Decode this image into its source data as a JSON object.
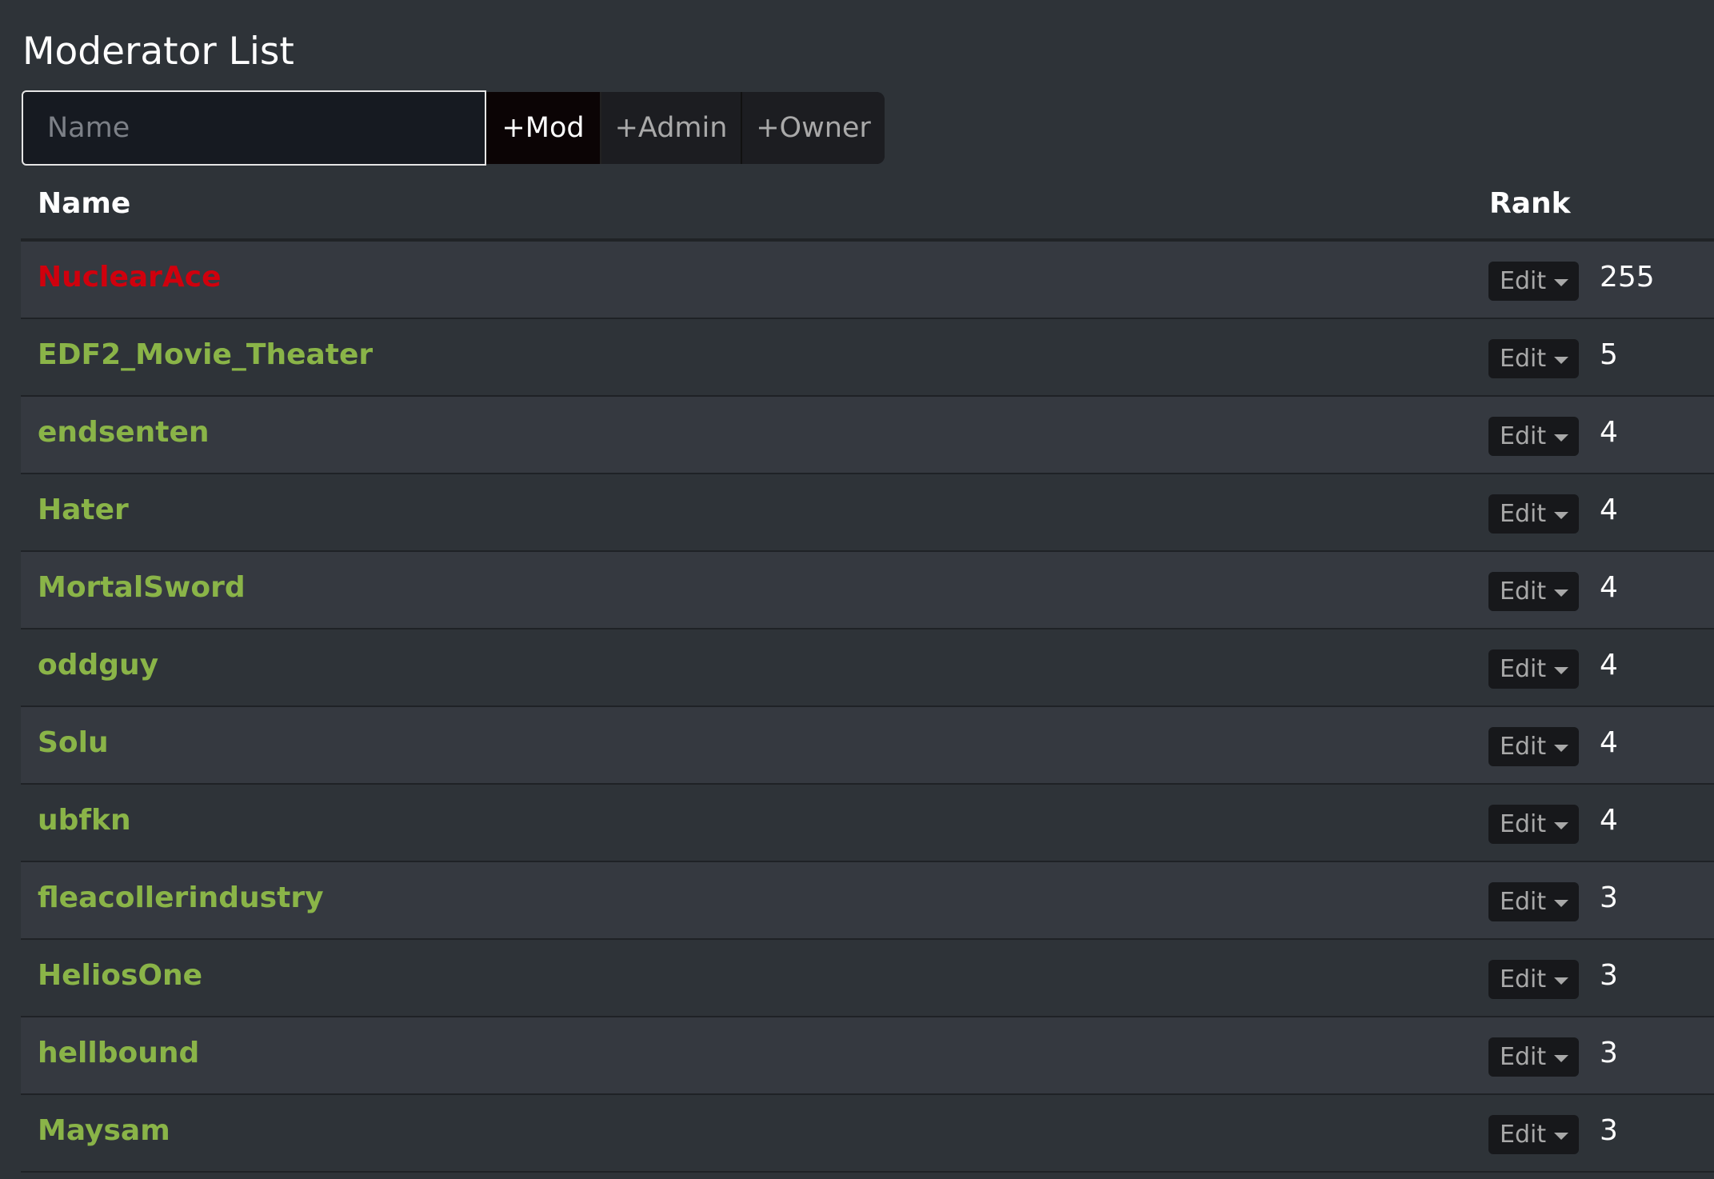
{
  "page": {
    "title": "Moderator List"
  },
  "add_form": {
    "name_placeholder": "Name",
    "mod_label": "+Mod",
    "admin_label": "+Admin",
    "owner_label": "+Owner"
  },
  "table": {
    "headers": {
      "name": "Name",
      "rank": "Rank"
    },
    "edit_label": "Edit",
    "rows": [
      {
        "name": "NuclearAce",
        "rank": "255",
        "color": "#d0000d"
      },
      {
        "name": "EDF2_Movie_Theater",
        "rank": "5",
        "color": "#8ab448"
      },
      {
        "name": "endsenten",
        "rank": "4",
        "color": "#8ab448"
      },
      {
        "name": "Hater",
        "rank": "4",
        "color": "#8ab448"
      },
      {
        "name": "MortalSword",
        "rank": "4",
        "color": "#8ab448"
      },
      {
        "name": "oddguy",
        "rank": "4",
        "color": "#8ab448"
      },
      {
        "name": "Solu",
        "rank": "4",
        "color": "#8ab448"
      },
      {
        "name": "ubfkn",
        "rank": "4",
        "color": "#8ab448"
      },
      {
        "name": "fleacollerindustry",
        "rank": "3",
        "color": "#8ab448"
      },
      {
        "name": "HeliosOne",
        "rank": "3",
        "color": "#8ab448"
      },
      {
        "name": "hellbound",
        "rank": "3",
        "color": "#8ab448"
      },
      {
        "name": "Maysam",
        "rank": "3",
        "color": "#8ab448"
      }
    ]
  },
  "colors": {
    "background": "#2e3338",
    "row_alt": "#353940",
    "owner_name": "#d0000d",
    "mod_name": "#8ab448"
  }
}
